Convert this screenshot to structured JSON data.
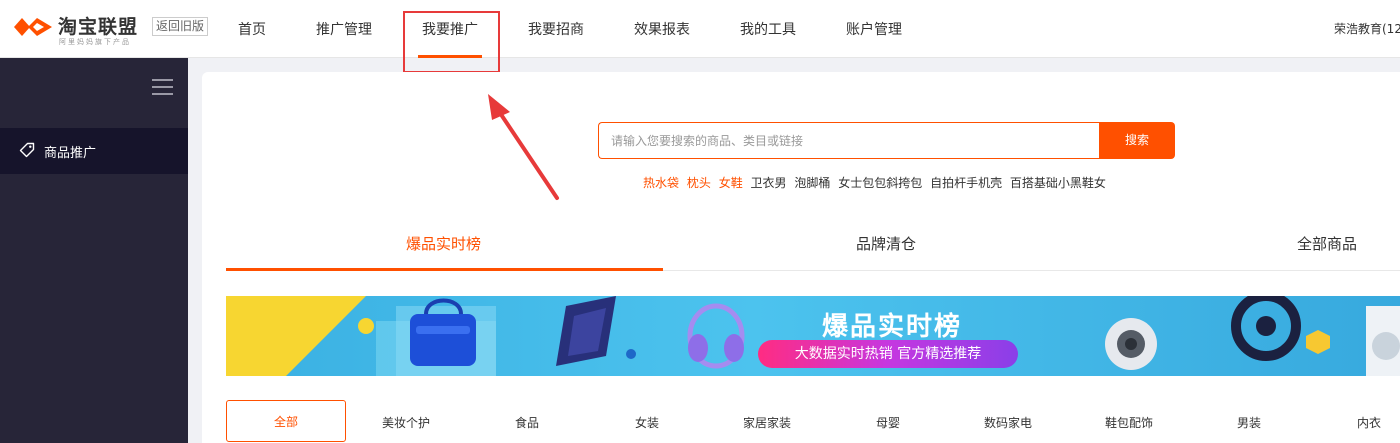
{
  "header": {
    "logo_text": "淘宝联盟",
    "logo_sub": "阿里妈妈旗下产品",
    "back_old": "返回旧版",
    "nav": [
      "首页",
      "推广管理",
      "我要推广",
      "我要招商",
      "效果报表",
      "我的工具",
      "账户管理"
    ],
    "active_nav": "我要推广",
    "user": "荣浩教育(12"
  },
  "sidebar": {
    "items": [
      {
        "label": "商品推广",
        "icon": "tag-icon"
      }
    ]
  },
  "search": {
    "placeholder": "请输入您要搜索的商品、类目或链接",
    "button": "搜索",
    "hot_words": [
      "热水袋",
      "枕头",
      "女鞋",
      "卫衣男",
      "泡脚桶",
      "女士包包斜挎包",
      "自拍杆手机壳",
      "百搭基础小黑鞋女"
    ],
    "hot_highlight_count": 3
  },
  "tabs": [
    "爆品实时榜",
    "品牌清仓",
    "全部商品"
  ],
  "active_tab": "爆品实时榜",
  "banner": {
    "title": "爆品实时榜",
    "subtitle": "大数据实时热销 官方精选推荐"
  },
  "categories": [
    "全部",
    "美妆个护",
    "食品",
    "女装",
    "家居家装",
    "母婴",
    "数码家电",
    "鞋包配饰",
    "男装",
    "内衣"
  ],
  "colors": {
    "accent": "#ff5000",
    "sidebar_bg": "#272538",
    "sidebar_active": "#16142b",
    "annotation_red": "#e73a3a"
  }
}
